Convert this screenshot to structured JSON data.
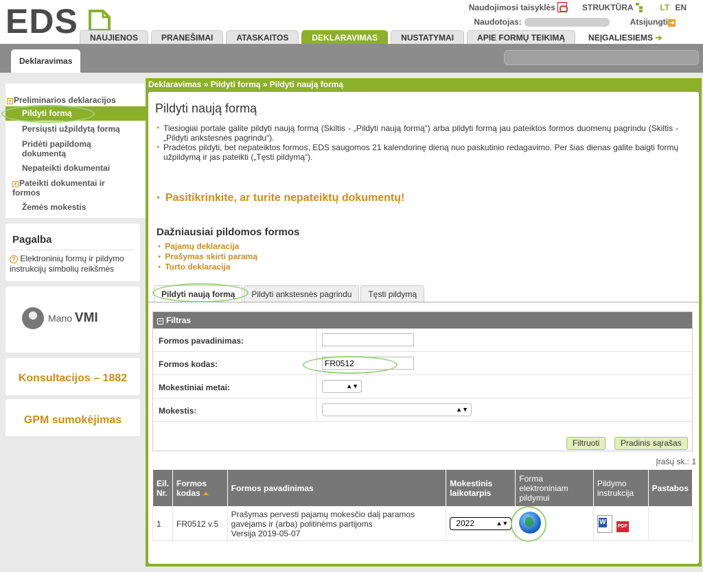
{
  "header": {
    "logo_text": "EDS",
    "toplinks": {
      "rules": "Naudojimosi taisyklės",
      "structure": "STRUKTŪRA",
      "lang_lt": "LT",
      "lang_en": "EN"
    },
    "user_label": "Naudotojas:",
    "logout_label": "Atsijungti",
    "nav": [
      "NAUJIENOS",
      "PRANEŠIMAI",
      "ATASKAITOS",
      "DEKLARAVIMAS",
      "NUSTATYMAI",
      "APIE FORMŲ TEIKIMĄ",
      "NEĮGALIESIEMS"
    ]
  },
  "subbar": {
    "tab": "Deklaravimas"
  },
  "sidebar": {
    "items": [
      "Preliminarios deklaracijos",
      "Pildyti formą",
      "Persiųsti užpildytą formą",
      "Pridėti papildomą dokumentą",
      "Nepateikti dokumentai",
      "Pateikti dokumentai ir formos",
      "Žemės mokestis"
    ],
    "help_title": "Pagalba",
    "help_text": "Elektroninių formų ir pildymo instrukcijų simbolių reikšmės",
    "mvmi_a": "Mano",
    "mvmi_b": "VMI",
    "consult": "Konsultacijos – 1882",
    "gpm": "GPM sumokėjimas"
  },
  "main": {
    "breadcrumb": "Deklaravimas » Pildyti formą » Pildyti naują formą",
    "title": "Pildyti naują formą",
    "bullet1": "Tiesiogiai portale galite pildyti naują formą (Skiltis - „Pildyti naują formą“) arba pildyti formą jau pateiktos formos duomenų pagrindu (Skiltis - „Pildyti ankstesnės pagrindu“).",
    "bullet2": "Pradėtos pildyti, bet nepateiktos formos, EDS saugomos 21 kalendorinę dieną nuo paskutinio redagavimo. Per šias dienas galite baigti formų užpildymą ir jas pateikti („Tęsti pildymą“).",
    "check_link": "Pasitikrinkite, ar turite nepateiktų dokumentų!",
    "freq_title": "Dažniausiai pildomos formos",
    "freq": [
      "Pajamų deklaracija",
      "Prašymas skirti paramą",
      "Turto deklaracija"
    ],
    "tabs": [
      "Pildyti naują formą",
      "Pildyti ankstesnės pagrindu",
      "Tęsti pildymą"
    ]
  },
  "filter": {
    "title": "Filtras",
    "name_label": "Formos pavadinimas:",
    "name_value": "",
    "code_label": "Formos kodas:",
    "code_value": "FR0512",
    "year_label": "Mokestiniai metai:",
    "tax_label": "Mokestis:",
    "filter_btn": "Filtruoti",
    "reset_btn": "Pradinis sąrašas"
  },
  "results": {
    "count": "Įrašų sk.: 1",
    "headers": [
      "Eil. Nr.",
      "Formos kodas",
      "Formos pavadinimas",
      "Mokestinis laikotarpis",
      "Forma elektroniniam pildymui",
      "Pildymo instrukcija",
      "Pastabos"
    ],
    "rows": [
      {
        "nr": "1",
        "code": "FR0512 v.5",
        "name": "Prašymas pervesti pajamų mokesčio dalį paramos gavėjams ir (arba) politinėms partijoms",
        "version": "Versija 2019-05-07",
        "year": "2022",
        "notes": ""
      }
    ]
  },
  "colors": {
    "accent": "#8cb02a",
    "orange": "#d08c1d",
    "header_gray": "#777777"
  }
}
